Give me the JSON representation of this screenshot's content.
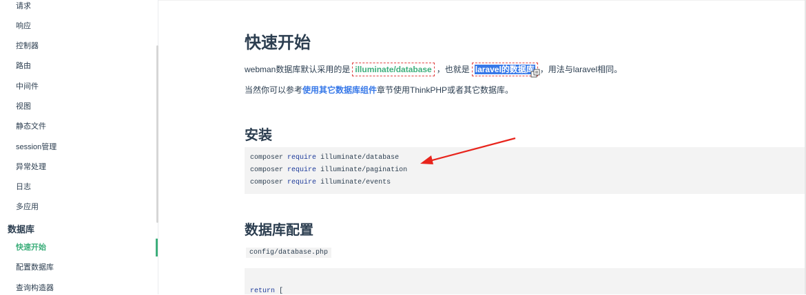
{
  "sidebar": {
    "items": [
      {
        "label": "请求"
      },
      {
        "label": "响应"
      },
      {
        "label": "控制器"
      },
      {
        "label": "路由"
      },
      {
        "label": "中间件"
      },
      {
        "label": "视图"
      },
      {
        "label": "静态文件"
      },
      {
        "label": "session管理"
      },
      {
        "label": "异常处理"
      },
      {
        "label": "日志"
      },
      {
        "label": "多应用"
      }
    ],
    "group_title": "数据库",
    "sub_items": [
      {
        "label": "快速开始"
      },
      {
        "label": "配置数据库"
      },
      {
        "label": "查询构造器"
      }
    ]
  },
  "main": {
    "title": "快速开始",
    "intro": {
      "prefix": "webman数据库默认采用的是",
      "link1": "illuminate/database",
      "middle": "，也就是",
      "link2": "laravel的数据库",
      "suffix": "，用法与laravel相同。"
    },
    "intro2": {
      "prefix": "当然你可以参考",
      "link": "使用其它数据库组件",
      "suffix": "章节使用ThinkPHP或者其它数据库。"
    },
    "install_title": "安装",
    "install_code": [
      {
        "cmd": "composer",
        "kw": "require",
        "pkg": "illuminate/database"
      },
      {
        "cmd": "composer",
        "kw": "require",
        "pkg": "illuminate/pagination"
      },
      {
        "cmd": "composer",
        "kw": "require",
        "pkg": "illuminate/events"
      }
    ],
    "config_title": "数据库配置",
    "config_file": "config/database.php",
    "config_code_line1": {
      "kw": "return",
      "rest": " ["
    }
  },
  "colors": {
    "accent": "#3eaf7c",
    "arrow": "#e8241c",
    "highlight": "#3778e8"
  },
  "icons": [
    "copy-icon",
    "arrow-annotation"
  ]
}
